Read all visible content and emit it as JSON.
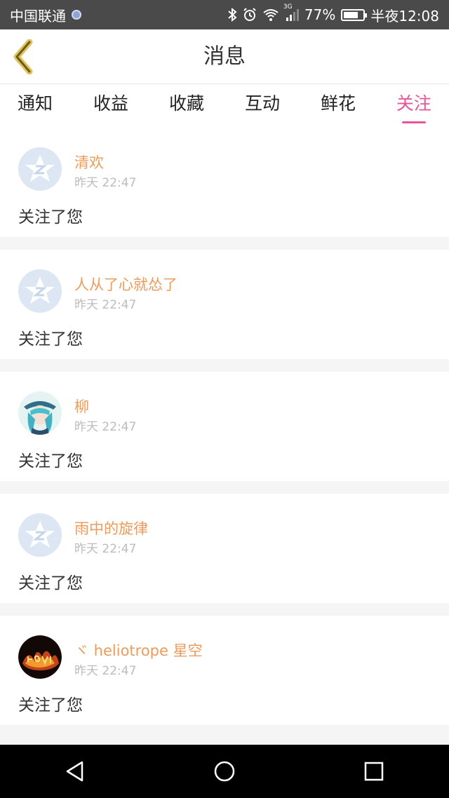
{
  "status_bar": {
    "carrier": "中国联通",
    "network": "3G",
    "battery": "77%",
    "battery_level": 0.77,
    "time": "半夜12:08"
  },
  "header": {
    "title": "消息"
  },
  "tabs": [
    {
      "label": "通知",
      "active": false
    },
    {
      "label": "收益",
      "active": false
    },
    {
      "label": "收藏",
      "active": false
    },
    {
      "label": "互动",
      "active": false
    },
    {
      "label": "鲜花",
      "active": false
    },
    {
      "label": "关注",
      "active": true
    }
  ],
  "messages": [
    {
      "name": "清欢",
      "time": "昨天 22:47",
      "text": "关注了您",
      "avatar": "default-avatar-icon"
    },
    {
      "name": "人从了心就怂了",
      "time": "昨天 22:47",
      "text": "关注了您",
      "avatar": "default-avatar-icon"
    },
    {
      "name": "柳",
      "time": "昨天 22:47",
      "text": "关注了您",
      "avatar": "anime-avatar"
    },
    {
      "name": "雨中的旋律",
      "time": "昨天 22:47",
      "text": "关注了您",
      "avatar": "default-avatar-icon"
    },
    {
      "name": "ヾ heliotrope 星空",
      "time": "昨天 22:47",
      "text": "关注了您",
      "avatar": "fire-avatar"
    }
  ],
  "colors": {
    "accent": "#e8559a",
    "username": "#ee9b5b",
    "time": "#bcbcbc"
  }
}
